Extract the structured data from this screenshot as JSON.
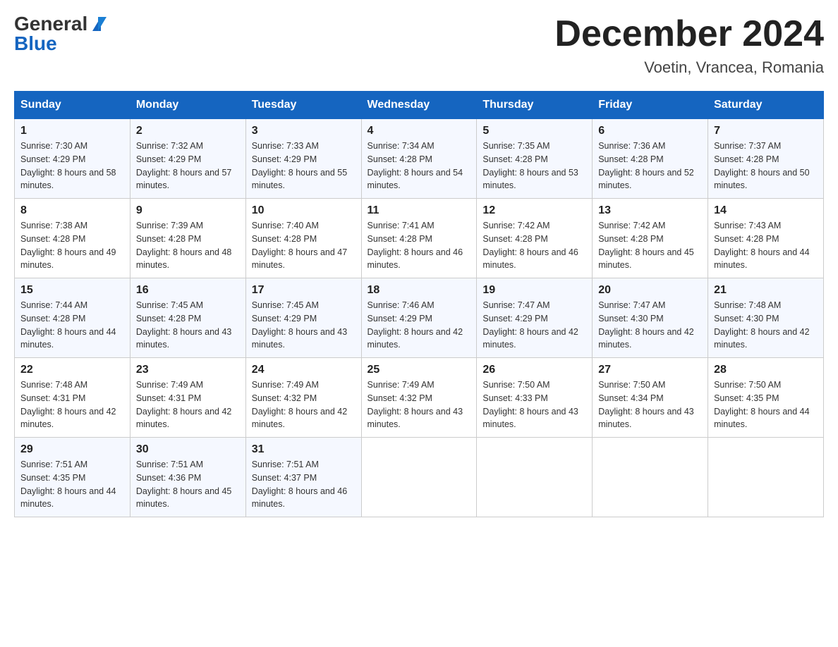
{
  "header": {
    "logo_general": "General",
    "logo_blue": "Blue",
    "month_title": "December 2024",
    "location": "Voetin, Vrancea, Romania"
  },
  "columns": [
    "Sunday",
    "Monday",
    "Tuesday",
    "Wednesday",
    "Thursday",
    "Friday",
    "Saturday"
  ],
  "weeks": [
    [
      {
        "day": "1",
        "sunrise": "7:30 AM",
        "sunset": "4:29 PM",
        "daylight": "8 hours and 58 minutes."
      },
      {
        "day": "2",
        "sunrise": "7:32 AM",
        "sunset": "4:29 PM",
        "daylight": "8 hours and 57 minutes."
      },
      {
        "day": "3",
        "sunrise": "7:33 AM",
        "sunset": "4:29 PM",
        "daylight": "8 hours and 55 minutes."
      },
      {
        "day": "4",
        "sunrise": "7:34 AM",
        "sunset": "4:28 PM",
        "daylight": "8 hours and 54 minutes."
      },
      {
        "day": "5",
        "sunrise": "7:35 AM",
        "sunset": "4:28 PM",
        "daylight": "8 hours and 53 minutes."
      },
      {
        "day": "6",
        "sunrise": "7:36 AM",
        "sunset": "4:28 PM",
        "daylight": "8 hours and 52 minutes."
      },
      {
        "day": "7",
        "sunrise": "7:37 AM",
        "sunset": "4:28 PM",
        "daylight": "8 hours and 50 minutes."
      }
    ],
    [
      {
        "day": "8",
        "sunrise": "7:38 AM",
        "sunset": "4:28 PM",
        "daylight": "8 hours and 49 minutes."
      },
      {
        "day": "9",
        "sunrise": "7:39 AM",
        "sunset": "4:28 PM",
        "daylight": "8 hours and 48 minutes."
      },
      {
        "day": "10",
        "sunrise": "7:40 AM",
        "sunset": "4:28 PM",
        "daylight": "8 hours and 47 minutes."
      },
      {
        "day": "11",
        "sunrise": "7:41 AM",
        "sunset": "4:28 PM",
        "daylight": "8 hours and 46 minutes."
      },
      {
        "day": "12",
        "sunrise": "7:42 AM",
        "sunset": "4:28 PM",
        "daylight": "8 hours and 46 minutes."
      },
      {
        "day": "13",
        "sunrise": "7:42 AM",
        "sunset": "4:28 PM",
        "daylight": "8 hours and 45 minutes."
      },
      {
        "day": "14",
        "sunrise": "7:43 AM",
        "sunset": "4:28 PM",
        "daylight": "8 hours and 44 minutes."
      }
    ],
    [
      {
        "day": "15",
        "sunrise": "7:44 AM",
        "sunset": "4:28 PM",
        "daylight": "8 hours and 44 minutes."
      },
      {
        "day": "16",
        "sunrise": "7:45 AM",
        "sunset": "4:28 PM",
        "daylight": "8 hours and 43 minutes."
      },
      {
        "day": "17",
        "sunrise": "7:45 AM",
        "sunset": "4:29 PM",
        "daylight": "8 hours and 43 minutes."
      },
      {
        "day": "18",
        "sunrise": "7:46 AM",
        "sunset": "4:29 PM",
        "daylight": "8 hours and 42 minutes."
      },
      {
        "day": "19",
        "sunrise": "7:47 AM",
        "sunset": "4:29 PM",
        "daylight": "8 hours and 42 minutes."
      },
      {
        "day": "20",
        "sunrise": "7:47 AM",
        "sunset": "4:30 PM",
        "daylight": "8 hours and 42 minutes."
      },
      {
        "day": "21",
        "sunrise": "7:48 AM",
        "sunset": "4:30 PM",
        "daylight": "8 hours and 42 minutes."
      }
    ],
    [
      {
        "day": "22",
        "sunrise": "7:48 AM",
        "sunset": "4:31 PM",
        "daylight": "8 hours and 42 minutes."
      },
      {
        "day": "23",
        "sunrise": "7:49 AM",
        "sunset": "4:31 PM",
        "daylight": "8 hours and 42 minutes."
      },
      {
        "day": "24",
        "sunrise": "7:49 AM",
        "sunset": "4:32 PM",
        "daylight": "8 hours and 42 minutes."
      },
      {
        "day": "25",
        "sunrise": "7:49 AM",
        "sunset": "4:32 PM",
        "daylight": "8 hours and 43 minutes."
      },
      {
        "day": "26",
        "sunrise": "7:50 AM",
        "sunset": "4:33 PM",
        "daylight": "8 hours and 43 minutes."
      },
      {
        "day": "27",
        "sunrise": "7:50 AM",
        "sunset": "4:34 PM",
        "daylight": "8 hours and 43 minutes."
      },
      {
        "day": "28",
        "sunrise": "7:50 AM",
        "sunset": "4:35 PM",
        "daylight": "8 hours and 44 minutes."
      }
    ],
    [
      {
        "day": "29",
        "sunrise": "7:51 AM",
        "sunset": "4:35 PM",
        "daylight": "8 hours and 44 minutes."
      },
      {
        "day": "30",
        "sunrise": "7:51 AM",
        "sunset": "4:36 PM",
        "daylight": "8 hours and 45 minutes."
      },
      {
        "day": "31",
        "sunrise": "7:51 AM",
        "sunset": "4:37 PM",
        "daylight": "8 hours and 46 minutes."
      },
      null,
      null,
      null,
      null
    ]
  ]
}
